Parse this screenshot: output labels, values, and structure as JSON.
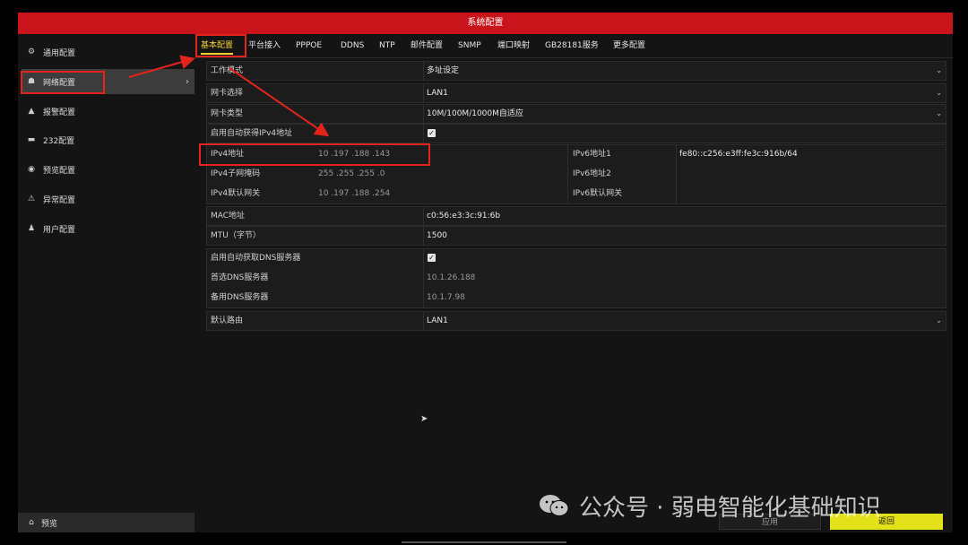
{
  "window": {
    "title": "系统配置"
  },
  "sidebar": {
    "items": [
      {
        "icon": "gear-icon",
        "glyph": "⚙",
        "label": "通用配置"
      },
      {
        "icon": "network-icon",
        "glyph": "☗",
        "label": "网络配置"
      },
      {
        "icon": "alarm-icon",
        "glyph": "▲",
        "label": "报警配置"
      },
      {
        "icon": "serial-icon",
        "glyph": "▬",
        "label": "232配置"
      },
      {
        "icon": "eye-icon",
        "glyph": "◉",
        "label": "预览配置"
      },
      {
        "icon": "warning-icon",
        "glyph": "⚠",
        "label": "异常配置"
      },
      {
        "icon": "users-icon",
        "glyph": "♟",
        "label": "用户配置"
      }
    ],
    "active_index": 1,
    "preview": {
      "icon": "home-icon",
      "glyph": "⌂",
      "label": "预览"
    }
  },
  "tabs": [
    "基本配置",
    "平台接入",
    "PPPOE",
    "DDNS",
    "NTP",
    "邮件配置",
    "SNMP",
    "端口映射",
    "GB28181服务",
    "更多配置"
  ],
  "form": {
    "work_mode": {
      "label": "工作模式",
      "value": "多址设定"
    },
    "nic_select": {
      "label": "网卡选择",
      "value": "LAN1"
    },
    "nic_type": {
      "label": "网卡类型",
      "value": "10M/100M/1000M自适应"
    },
    "dhcp_ipv4": {
      "label": "启用自动获得IPv4地址",
      "checked": true
    },
    "ipv4_addr": {
      "label": "IPv4地址",
      "value": "10  .197 .188 .143"
    },
    "ipv4_mask": {
      "label": "IPv4子网掩码",
      "value": "255 .255 .255 .0"
    },
    "ipv4_gw": {
      "label": "IPv4默认网关",
      "value": "10  .197 .188 .254"
    },
    "ipv6_addr1": {
      "label": "IPv6地址1",
      "value": "fe80::c256:e3ff:fe3c:916b/64"
    },
    "ipv6_addr2": {
      "label": "IPv6地址2",
      "value": ""
    },
    "ipv6_gw": {
      "label": "IPv6默认网关",
      "value": ""
    },
    "mac": {
      "label": "MAC地址",
      "value": "c0:56:e3:3c:91:6b"
    },
    "mtu": {
      "label": "MTU（字节）",
      "value": "1500"
    },
    "dhcp_dns": {
      "label": "启用自动获取DNS服务器",
      "checked": true
    },
    "dns1": {
      "label": "首选DNS服务器",
      "value": "10.1.26.188"
    },
    "dns2": {
      "label": "备用DNS服务器",
      "value": "10.1.7.98"
    },
    "default_route": {
      "label": "默认路由",
      "value": "LAN1"
    }
  },
  "buttons": {
    "apply": "应用",
    "back": "返回"
  },
  "watermark": {
    "text": "公众号 · 弱电智能化基础知识"
  },
  "colors": {
    "titlebar": "#c8141a",
    "accent": "#f0d23a",
    "back_button": "#e2e11a",
    "annotation": "#e2241c"
  },
  "glyphs": {
    "dropdown": "⌄",
    "check": "✓",
    "chevron": "›"
  }
}
